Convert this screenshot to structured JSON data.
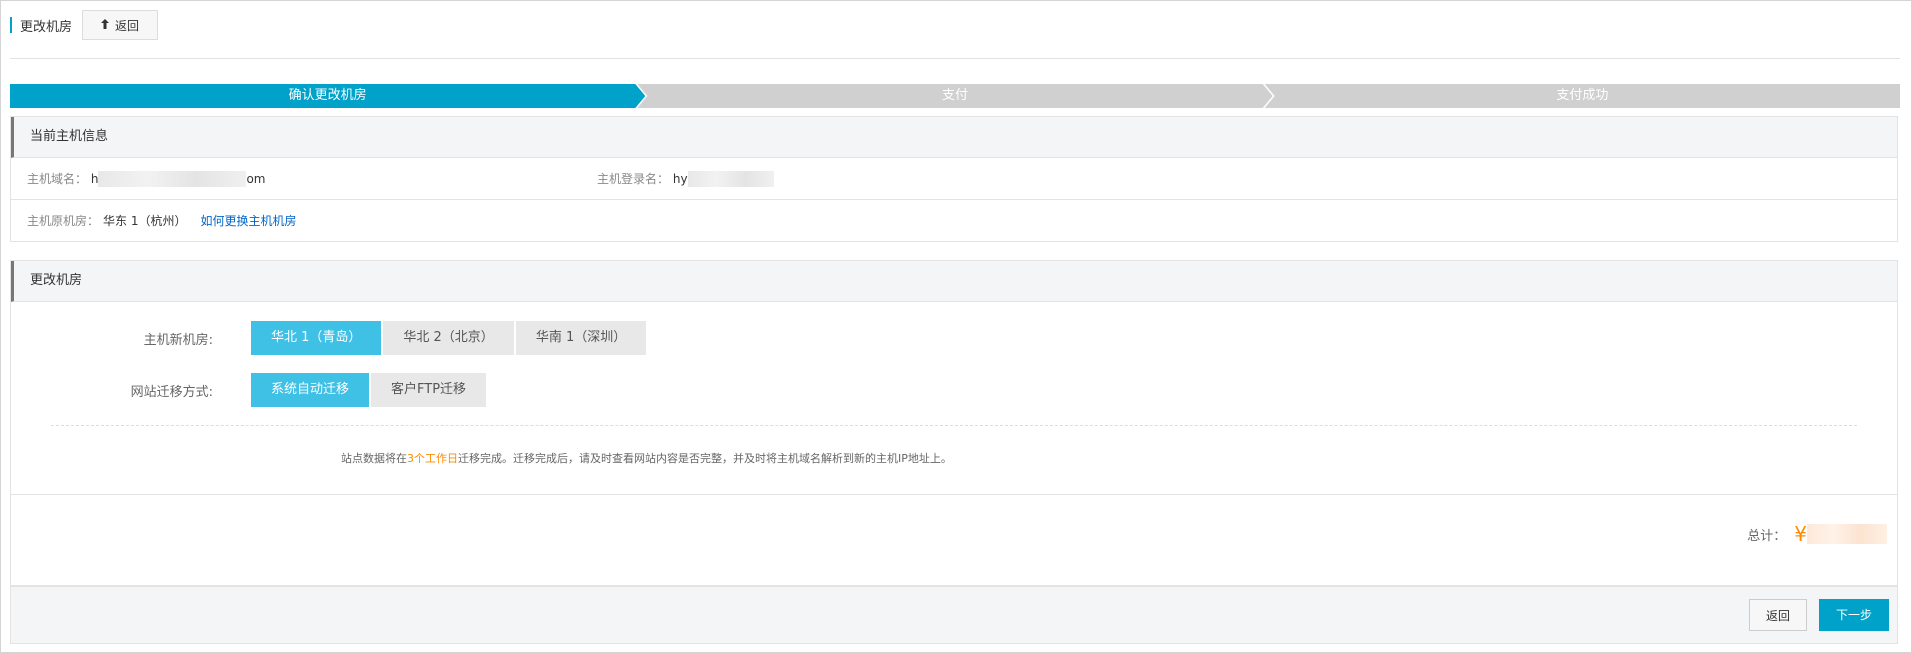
{
  "header": {
    "title": "更改机房",
    "back_label": "返回",
    "back_icon": "upload-arrow-icon"
  },
  "steps": [
    {
      "label": "确认更改机房",
      "state": "active"
    },
    {
      "label": "支付",
      "state": "pending"
    },
    {
      "label": "支付成功",
      "state": "pending"
    }
  ],
  "current_info": {
    "title": "当前主机信息",
    "domain_label": "主机域名：",
    "domain_prefix": "h",
    "domain_suffix": "om",
    "login_label": "主机登录名：",
    "login_prefix": "hy",
    "origin_label": "主机原机房：",
    "origin_value": "华东 1（杭州）",
    "change_link": "如何更换主机机房"
  },
  "change": {
    "title": "更改机房",
    "room_label": "主机新机房:",
    "rooms": [
      "华北 1（青岛）",
      "华北 2（北京）",
      "华南 1（深圳）"
    ],
    "room_selected": 0,
    "method_label": "网站迁移方式:",
    "methods": [
      "系统自动迁移",
      "客户FTP迁移"
    ],
    "method_selected": 0,
    "note_before": "站点数据将在",
    "note_highlight": "3个工作日",
    "note_after": "迁移完成。迁移完成后，请及时查看网站内容是否完整，并及时将主机域名解析到新的主机IP地址上。"
  },
  "total": {
    "label": "总计：",
    "currency": "¥"
  },
  "footer": {
    "back_label": "返回",
    "next_label": "下一步"
  },
  "colors": {
    "accent": "#00a2ca",
    "option_active": "#3fc1e6",
    "highlight": "#ff8a00"
  }
}
